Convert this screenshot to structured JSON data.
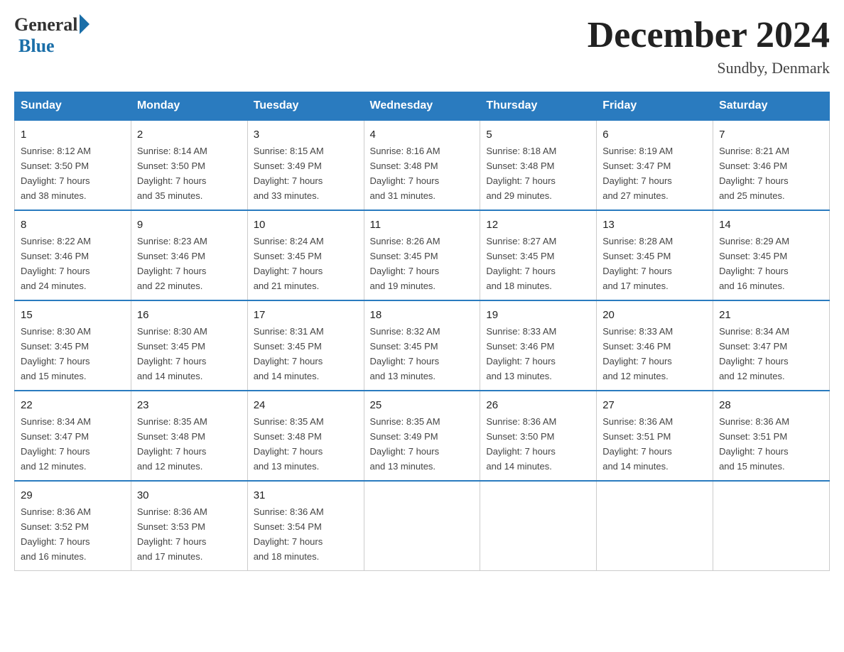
{
  "header": {
    "logo_general": "General",
    "logo_blue": "Blue",
    "title": "December 2024",
    "location": "Sundby, Denmark"
  },
  "days_of_week": [
    "Sunday",
    "Monday",
    "Tuesday",
    "Wednesday",
    "Thursday",
    "Friday",
    "Saturday"
  ],
  "weeks": [
    [
      {
        "day": "1",
        "info": "Sunrise: 8:12 AM\nSunset: 3:50 PM\nDaylight: 7 hours\nand 38 minutes."
      },
      {
        "day": "2",
        "info": "Sunrise: 8:14 AM\nSunset: 3:50 PM\nDaylight: 7 hours\nand 35 minutes."
      },
      {
        "day": "3",
        "info": "Sunrise: 8:15 AM\nSunset: 3:49 PM\nDaylight: 7 hours\nand 33 minutes."
      },
      {
        "day": "4",
        "info": "Sunrise: 8:16 AM\nSunset: 3:48 PM\nDaylight: 7 hours\nand 31 minutes."
      },
      {
        "day": "5",
        "info": "Sunrise: 8:18 AM\nSunset: 3:48 PM\nDaylight: 7 hours\nand 29 minutes."
      },
      {
        "day": "6",
        "info": "Sunrise: 8:19 AM\nSunset: 3:47 PM\nDaylight: 7 hours\nand 27 minutes."
      },
      {
        "day": "7",
        "info": "Sunrise: 8:21 AM\nSunset: 3:46 PM\nDaylight: 7 hours\nand 25 minutes."
      }
    ],
    [
      {
        "day": "8",
        "info": "Sunrise: 8:22 AM\nSunset: 3:46 PM\nDaylight: 7 hours\nand 24 minutes."
      },
      {
        "day": "9",
        "info": "Sunrise: 8:23 AM\nSunset: 3:46 PM\nDaylight: 7 hours\nand 22 minutes."
      },
      {
        "day": "10",
        "info": "Sunrise: 8:24 AM\nSunset: 3:45 PM\nDaylight: 7 hours\nand 21 minutes."
      },
      {
        "day": "11",
        "info": "Sunrise: 8:26 AM\nSunset: 3:45 PM\nDaylight: 7 hours\nand 19 minutes."
      },
      {
        "day": "12",
        "info": "Sunrise: 8:27 AM\nSunset: 3:45 PM\nDaylight: 7 hours\nand 18 minutes."
      },
      {
        "day": "13",
        "info": "Sunrise: 8:28 AM\nSunset: 3:45 PM\nDaylight: 7 hours\nand 17 minutes."
      },
      {
        "day": "14",
        "info": "Sunrise: 8:29 AM\nSunset: 3:45 PM\nDaylight: 7 hours\nand 16 minutes."
      }
    ],
    [
      {
        "day": "15",
        "info": "Sunrise: 8:30 AM\nSunset: 3:45 PM\nDaylight: 7 hours\nand 15 minutes."
      },
      {
        "day": "16",
        "info": "Sunrise: 8:30 AM\nSunset: 3:45 PM\nDaylight: 7 hours\nand 14 minutes."
      },
      {
        "day": "17",
        "info": "Sunrise: 8:31 AM\nSunset: 3:45 PM\nDaylight: 7 hours\nand 14 minutes."
      },
      {
        "day": "18",
        "info": "Sunrise: 8:32 AM\nSunset: 3:45 PM\nDaylight: 7 hours\nand 13 minutes."
      },
      {
        "day": "19",
        "info": "Sunrise: 8:33 AM\nSunset: 3:46 PM\nDaylight: 7 hours\nand 13 minutes."
      },
      {
        "day": "20",
        "info": "Sunrise: 8:33 AM\nSunset: 3:46 PM\nDaylight: 7 hours\nand 12 minutes."
      },
      {
        "day": "21",
        "info": "Sunrise: 8:34 AM\nSunset: 3:47 PM\nDaylight: 7 hours\nand 12 minutes."
      }
    ],
    [
      {
        "day": "22",
        "info": "Sunrise: 8:34 AM\nSunset: 3:47 PM\nDaylight: 7 hours\nand 12 minutes."
      },
      {
        "day": "23",
        "info": "Sunrise: 8:35 AM\nSunset: 3:48 PM\nDaylight: 7 hours\nand 12 minutes."
      },
      {
        "day": "24",
        "info": "Sunrise: 8:35 AM\nSunset: 3:48 PM\nDaylight: 7 hours\nand 13 minutes."
      },
      {
        "day": "25",
        "info": "Sunrise: 8:35 AM\nSunset: 3:49 PM\nDaylight: 7 hours\nand 13 minutes."
      },
      {
        "day": "26",
        "info": "Sunrise: 8:36 AM\nSunset: 3:50 PM\nDaylight: 7 hours\nand 14 minutes."
      },
      {
        "day": "27",
        "info": "Sunrise: 8:36 AM\nSunset: 3:51 PM\nDaylight: 7 hours\nand 14 minutes."
      },
      {
        "day": "28",
        "info": "Sunrise: 8:36 AM\nSunset: 3:51 PM\nDaylight: 7 hours\nand 15 minutes."
      }
    ],
    [
      {
        "day": "29",
        "info": "Sunrise: 8:36 AM\nSunset: 3:52 PM\nDaylight: 7 hours\nand 16 minutes."
      },
      {
        "day": "30",
        "info": "Sunrise: 8:36 AM\nSunset: 3:53 PM\nDaylight: 7 hours\nand 17 minutes."
      },
      {
        "day": "31",
        "info": "Sunrise: 8:36 AM\nSunset: 3:54 PM\nDaylight: 7 hours\nand 18 minutes."
      },
      {
        "day": "",
        "info": ""
      },
      {
        "day": "",
        "info": ""
      },
      {
        "day": "",
        "info": ""
      },
      {
        "day": "",
        "info": ""
      }
    ]
  ]
}
